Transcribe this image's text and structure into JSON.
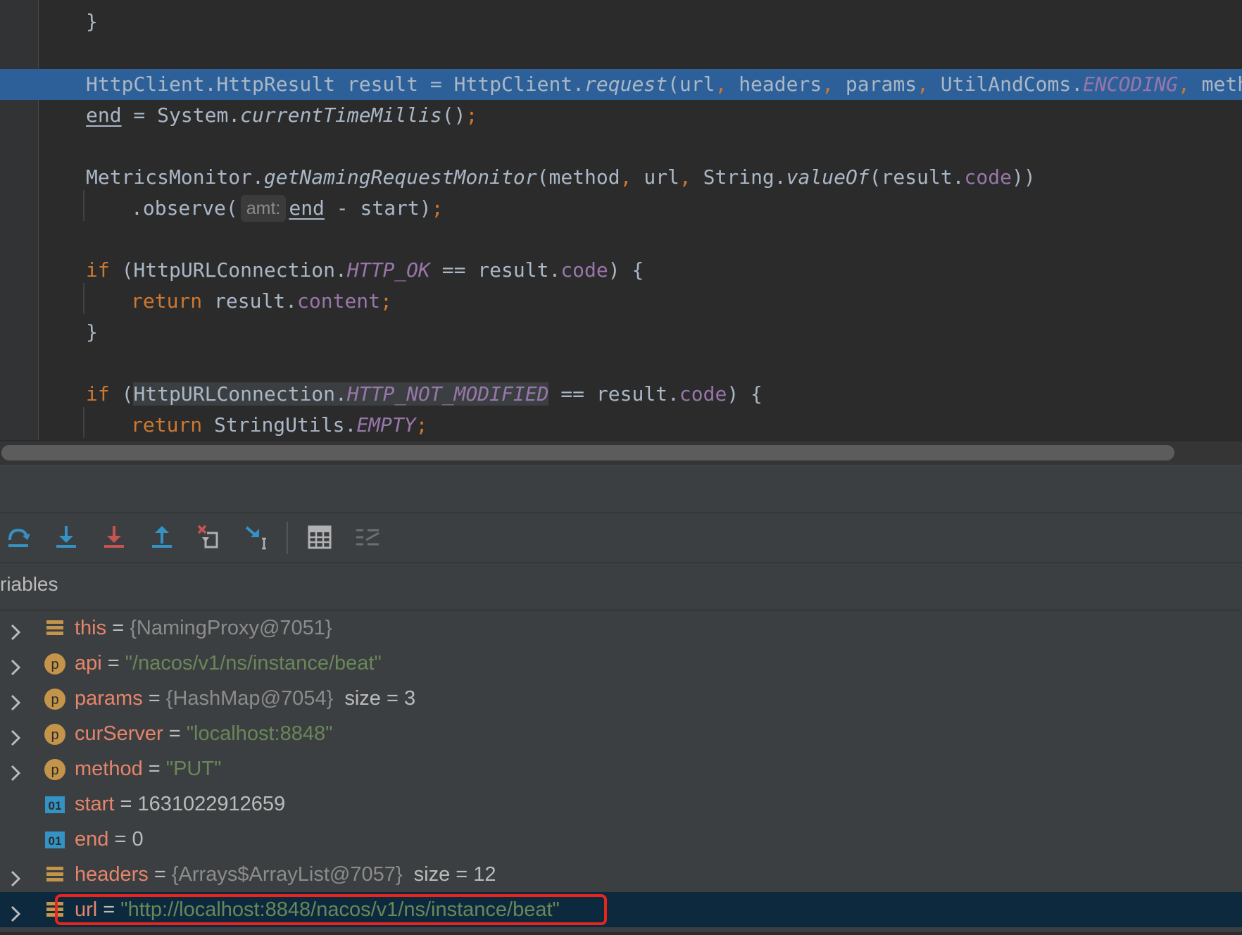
{
  "editor": {
    "lines": [
      {
        "id": "l1",
        "segments": [
          [
            "}",
            ""
          ]
        ]
      },
      {
        "id": "l2",
        "segments": [
          [
            "HttpClient.HttpResult result = HttpClient.",
            ""
          ],
          [
            "request",
            "it"
          ],
          [
            "(url",
            ""
          ],
          [
            ", ",
            "kw"
          ],
          [
            "headers",
            ""
          ],
          [
            ", ",
            "kw"
          ],
          [
            "params",
            ""
          ],
          [
            ", ",
            "kw"
          ],
          [
            "UtilAndComs.",
            ""
          ],
          [
            "ENCODING",
            "sfld"
          ],
          [
            ", ",
            "kw"
          ],
          [
            "method)",
            ""
          ],
          [
            ";",
            "kw"
          ]
        ]
      },
      {
        "id": "l3",
        "segments": [
          [
            "end",
            "ul"
          ],
          [
            " = System.",
            ""
          ],
          [
            "currentTimeMillis",
            "it"
          ],
          [
            "()",
            ""
          ],
          [
            ";",
            "kw"
          ]
        ]
      },
      {
        "id": "l4",
        "segments": [
          [
            "MetricsMonitor.",
            ""
          ],
          [
            "getNamingRequestMonitor",
            "it"
          ],
          [
            "(method",
            ""
          ],
          [
            ", ",
            "kw"
          ],
          [
            "url",
            ""
          ],
          [
            ", ",
            "kw"
          ],
          [
            "String.",
            ""
          ],
          [
            "valueOf",
            "it"
          ],
          [
            "(result.",
            ""
          ],
          [
            "code",
            "fld"
          ],
          [
            "))",
            ""
          ]
        ]
      },
      {
        "id": "l5",
        "segments": [
          [
            ".observe(",
            ""
          ]
        ],
        "hint": "amt:",
        "after": [
          [
            "end",
            "ul"
          ],
          [
            " - start)",
            ""
          ],
          [
            ";",
            "kw"
          ]
        ]
      },
      {
        "id": "l6",
        "segments": [
          [
            "if",
            "kw"
          ],
          [
            " (HttpURLConnection.",
            ""
          ],
          [
            "HTTP_OK",
            "sfld"
          ],
          [
            " == result.",
            ""
          ],
          [
            "code",
            "fld"
          ],
          [
            ") {",
            ""
          ]
        ]
      },
      {
        "id": "l7",
        "segments": [
          [
            "return",
            "kw"
          ],
          [
            " result.",
            ""
          ],
          [
            "content",
            "fld"
          ],
          [
            ";",
            "kw"
          ]
        ]
      },
      {
        "id": "l8",
        "segments": [
          [
            "}",
            ""
          ]
        ]
      },
      {
        "id": "l9",
        "segments": [
          [
            "if",
            "kw"
          ],
          [
            " (",
            ""
          ],
          [
            "HttpURLConnection.",
            "hlbg"
          ],
          [
            "HTTP_NOT_MODIFIED",
            "sfld hlbg"
          ],
          [
            " == result.",
            ""
          ],
          [
            "code",
            "fld"
          ],
          [
            ") {",
            ""
          ]
        ]
      },
      {
        "id": "l10",
        "segments": [
          [
            "return",
            "kw"
          ],
          [
            " StringUtils.",
            ""
          ],
          [
            "EMPTY",
            "sfld"
          ],
          [
            ";",
            "kw"
          ]
        ]
      }
    ]
  },
  "toolbar": {
    "buttons": [
      {
        "name": "step-over-icon"
      },
      {
        "name": "step-into-icon"
      },
      {
        "name": "force-step-into-icon"
      },
      {
        "name": "step-out-icon"
      },
      {
        "name": "drop-frame-icon"
      },
      {
        "name": "run-to-cursor-icon"
      },
      {
        "name": "evaluate-expression-icon"
      },
      {
        "name": "trace-stream-icon"
      }
    ]
  },
  "variables": {
    "title": "riables",
    "items": [
      {
        "name": "this",
        "value": "{NamingProxy@7051}",
        "value_kind": "ref",
        "extra": "",
        "icon": "field",
        "expandable": true
      },
      {
        "name": "api",
        "value": "\"/nacos/v1/ns/instance/beat\"",
        "value_kind": "str",
        "extra": "",
        "icon": "param",
        "expandable": true
      },
      {
        "name": "params",
        "value": "{HashMap@7054}",
        "value_kind": "ref",
        "extra": "size = 3",
        "icon": "param",
        "expandable": true
      },
      {
        "name": "curServer",
        "value": "\"localhost:8848\"",
        "value_kind": "str",
        "extra": "",
        "icon": "param",
        "expandable": true
      },
      {
        "name": "method",
        "value": "\"PUT\"",
        "value_kind": "str",
        "extra": "",
        "icon": "param",
        "expandable": true
      },
      {
        "name": "start",
        "value": "1631022912659",
        "value_kind": "num",
        "extra": "",
        "icon": "prim",
        "expandable": false
      },
      {
        "name": "end",
        "value": "0",
        "value_kind": "num",
        "extra": "",
        "icon": "prim",
        "expandable": false
      },
      {
        "name": "headers",
        "value": "{Arrays$ArrayList@7057}",
        "value_kind": "ref",
        "extra": "size = 12",
        "icon": "field",
        "expandable": true
      },
      {
        "name": "url",
        "value": "\"http://localhost:8848/nacos/v1/ns/instance/beat\"",
        "value_kind": "str",
        "extra": "",
        "icon": "field",
        "expandable": true,
        "selected": true
      }
    ]
  },
  "colors": {
    "editor_bg": "#2b2b2b",
    "current_line": "#2d6099",
    "keyword": "#cc7832",
    "field": "#9876aa",
    "string": "#6a8759",
    "var_name": "#e6856b",
    "selection": "#0d293e",
    "highlight_box": "#e8251c"
  }
}
